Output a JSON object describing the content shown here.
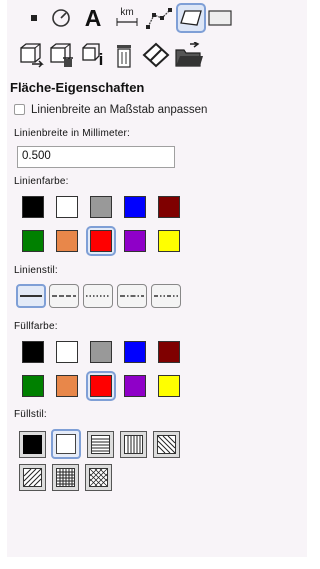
{
  "toolbar": {
    "tools": [
      {
        "name": "point-tool-icon"
      },
      {
        "name": "measure-icon"
      },
      {
        "name": "text-tool-icon",
        "glyph": "A"
      },
      {
        "name": "distance-tool-icon",
        "glyph": "km"
      },
      {
        "name": "polyline-tool-icon"
      },
      {
        "name": "polygon-tool-icon",
        "selected": true
      },
      {
        "name": "rectangle-tool-icon"
      },
      {
        "name": "move-copy-icon"
      },
      {
        "name": "delete-copy-icon"
      },
      {
        "name": "info-icon",
        "glyph": "i"
      },
      {
        "name": "trash-icon"
      },
      {
        "name": "eraser-icon"
      },
      {
        "name": "open-folder-icon"
      }
    ]
  },
  "properties": {
    "title": "Fläche-Eigenschaften",
    "scale_checkbox_label": "Linienbreite an Maßstab anpassen",
    "scale_checkbox_checked": false,
    "line_width_label": "Linienbreite in Millimeter:",
    "line_width_value": "0.500",
    "line_color_label": "Linienfarbe:",
    "line_style_label": "Linienstil:",
    "fill_color_label": "Füllfarbe:",
    "fill_style_label": "Füllstil:"
  },
  "palette": [
    "#000000",
    "#ffffff",
    "#999999",
    "#0000ff",
    "#7f0000",
    "#008000",
    "#e8874a",
    "#ff0000",
    "#8f00c8",
    "#ffff00"
  ],
  "line_color_selected": "#ff0000",
  "fill_color_selected": "#ff0000",
  "line_styles": [
    "solid",
    "dashed",
    "dotted",
    "dash-dot",
    "dash-dot-dot"
  ],
  "line_style_selected": "solid",
  "fill_styles": [
    "solid",
    "transparent",
    "horizontal",
    "vertical",
    "diagonal",
    "cross-diagonal",
    "grid",
    "diagonal-grid"
  ],
  "fill_style_selected": "transparent"
}
